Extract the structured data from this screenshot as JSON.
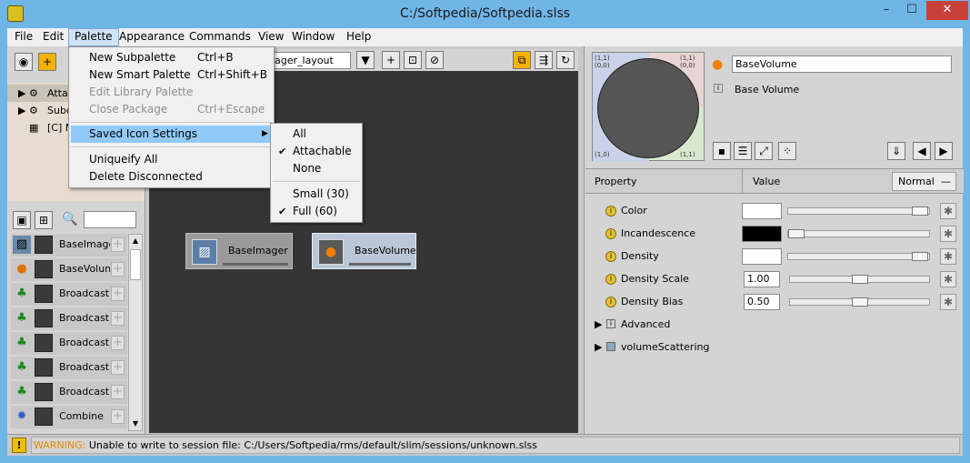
{
  "window": {
    "title": "C:/Softpedia/Softpedia.slss",
    "min": "–",
    "max": "☐",
    "close": "✕"
  },
  "menubar": [
    "File",
    "Edit",
    "Palette",
    "Appearance",
    "Commands",
    "View",
    "Window",
    "Help"
  ],
  "palette_menu": {
    "items": [
      {
        "label": "New Subpalette",
        "shortcut": "Ctrl+B"
      },
      {
        "label": "New Smart Palette",
        "shortcut": "Ctrl+Shift+B"
      },
      {
        "label": "Edit Library Palette",
        "shortcut": ""
      },
      {
        "label": "Close Package",
        "shortcut": "Ctrl+Escape"
      },
      {
        "label": "Saved Icon Settings",
        "shortcut": ""
      },
      {
        "label": "Uniqueify All",
        "shortcut": ""
      },
      {
        "label": "Delete Disconnected",
        "shortcut": ""
      }
    ]
  },
  "submenu": {
    "items": [
      {
        "label": "All",
        "check": false
      },
      {
        "label": "Attachable",
        "check": true
      },
      {
        "label": "None",
        "check": false
      },
      {
        "label": "Small (30)",
        "check": false
      },
      {
        "label": "Full (60)",
        "check": true
      }
    ],
    "checkmark": "✔"
  },
  "left_tree": [
    {
      "label": "Attac"
    },
    {
      "label": "Subc"
    },
    {
      "label": "[C] M"
    }
  ],
  "left_list": [
    {
      "label": "BaseImager"
    },
    {
      "label": "BaseVolume"
    },
    {
      "label": "Broadcast"
    },
    {
      "label": "Broadcast"
    },
    {
      "label": "Broadcast"
    },
    {
      "label": "Broadcast"
    },
    {
      "label": "Broadcast"
    },
    {
      "label": "Combine"
    }
  ],
  "canvas": {
    "layout_field": "ager_layout",
    "nodes": [
      {
        "label": "BaseImager",
        "selected": false
      },
      {
        "label": "BaseVolume",
        "selected": true
      }
    ]
  },
  "right_panel": {
    "name_field": "BaseVolume",
    "info_label": "Base Volume",
    "preview_corner_labels": [
      "(1,1)",
      "(0,0)",
      "(1,1)",
      "(0,0)",
      "(1,0)",
      "(1,1)"
    ],
    "table": {
      "col_property": "Property",
      "col_value": "Value",
      "mode": "Normal"
    },
    "properties": [
      {
        "label": "Color",
        "kind": "swatch",
        "color": "#ffffff"
      },
      {
        "label": "Incandescence",
        "kind": "swatch",
        "color": "#000000"
      },
      {
        "label": "Density",
        "kind": "swatch",
        "color": "#ffffff"
      },
      {
        "label": "Density Scale",
        "kind": "number",
        "value": "1.00"
      },
      {
        "label": "Density Bias",
        "kind": "number",
        "value": "0.50"
      }
    ],
    "groups": [
      "Advanced",
      "volumeScattering"
    ]
  },
  "status": {
    "prefix": "WARNING:",
    "message": "Unable to write to session file: C:/Users/Softpedia/rms/default/slim/sessions/unknown.slss"
  },
  "colors": {
    "titlebar": "#6fb5e6",
    "close": "#c7413a",
    "canvas": "#353535",
    "highlight": "#91c9f7"
  }
}
